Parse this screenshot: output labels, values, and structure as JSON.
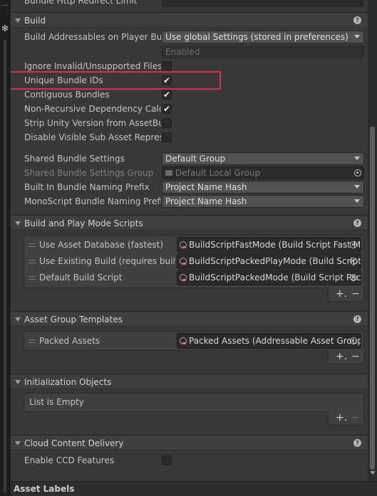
{
  "top_row_label": "Bundle Http Redirect Limit",
  "build": {
    "title": "Build",
    "build_on_player_label": "Build Addressables on Player Build",
    "build_on_player_value": "Use global Settings (stored in preferences)",
    "build_on_player_sub": "Enabled",
    "ignore_invalid_label": "Ignore Invalid/Unsupported Files in Build",
    "unique_bundle_ids_label": "Unique Bundle IDs",
    "contiguous_bundles_label": "Contiguous Bundles",
    "non_recursive_label": "Non-Recursive Dependency Calculation",
    "strip_unity_version_label": "Strip Unity Version from AssetBundles",
    "disable_visible_sub_label": "Disable Visible Sub Asset Representations",
    "shared_bundle_settings_label": "Shared Bundle Settings",
    "shared_bundle_settings_value": "Default Group",
    "shared_bundle_group_label": "Shared Bundle Settings Group",
    "shared_bundle_group_value": "Default Local Group",
    "builtin_naming_label": "Built In Bundle Naming Prefix",
    "builtin_naming_value": "Project Name Hash",
    "monoscript_naming_label": "MonoScript Bundle Naming Prefix",
    "monoscript_naming_value": "Project Name Hash"
  },
  "build_play_mode": {
    "title": "Build and Play Mode Scripts",
    "items": [
      {
        "label": "Use Asset Database (fastest)",
        "value": "BuildScriptFastMode (Build Script Fast Mode)"
      },
      {
        "label": "Use Existing Build (requires built groups)",
        "value": "BuildScriptPackedPlayMode (Build Script Packed Play Mode)"
      },
      {
        "label": "Default Build Script",
        "value": "BuildScriptPackedMode (Build Script Packed Mode)"
      }
    ],
    "add": "+.",
    "remove": "−"
  },
  "asset_group_templates": {
    "title": "Asset Group Templates",
    "items": [
      {
        "label": "Packed Assets",
        "value": "Packed Assets (Addressable Asset Group Template)"
      }
    ],
    "add": "+.",
    "remove": "−"
  },
  "initialization_objects": {
    "title": "Initialization Objects",
    "empty_text": "List is Empty",
    "add": "+.",
    "remove": "−"
  },
  "ccd": {
    "title": "Cloud Content Delivery",
    "enable_label": "Enable CCD Features"
  },
  "bottom": {
    "asset_labels": "Asset Labels"
  },
  "help_glyph": "?",
  "check_glyph": "✔",
  "colors": {
    "highlight": "#e0303a",
    "panel": "#383838",
    "header": "#3e3e3e"
  }
}
